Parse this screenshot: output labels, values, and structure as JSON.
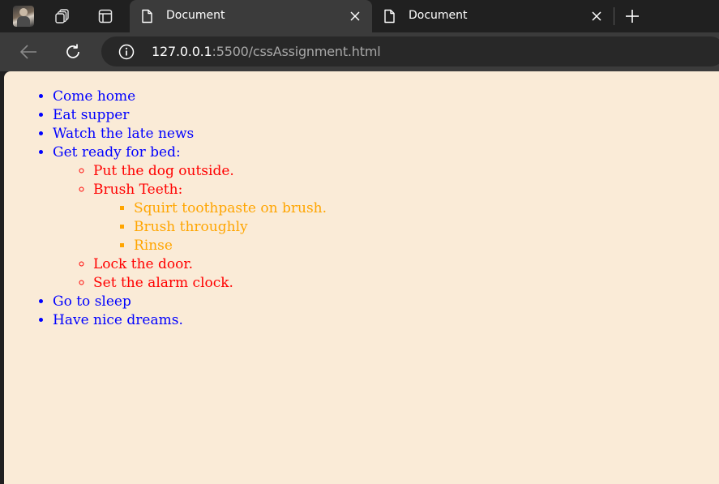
{
  "browser": {
    "tabs": [
      {
        "title": "Document",
        "active": true
      },
      {
        "title": "Document",
        "active": false
      }
    ],
    "address": {
      "host": "127.0.0.1",
      "path": ":5500/cssAssignment.html"
    },
    "icons": {
      "profile": "profile-avatar",
      "workspaces": "workspaces-icon",
      "tab_actions": "tab-actions-icon",
      "page": "page-icon",
      "close": "close-icon",
      "new_tab": "plus-icon",
      "back": "back-arrow-icon",
      "reload": "reload-icon",
      "info": "info-icon"
    }
  },
  "page": {
    "colors": {
      "background": "#faebd7",
      "level1": "#0000ff",
      "level2": "#ff0000",
      "level3": "#ffa500"
    },
    "list": [
      {
        "text": "Come home"
      },
      {
        "text": "Eat supper"
      },
      {
        "text": "Watch the late news"
      },
      {
        "text": "Get ready for bed:",
        "children": [
          {
            "text": "Put the dog outside."
          },
          {
            "text": "Brush Teeth:",
            "children": [
              {
                "text": "Squirt toothpaste on brush."
              },
              {
                "text": "Brush throughly"
              },
              {
                "text": "Rinse"
              }
            ]
          },
          {
            "text": "Lock the door."
          },
          {
            "text": "Set the alarm clock."
          }
        ]
      },
      {
        "text": "Go to sleep"
      },
      {
        "text": "Have nice dreams."
      }
    ]
  }
}
